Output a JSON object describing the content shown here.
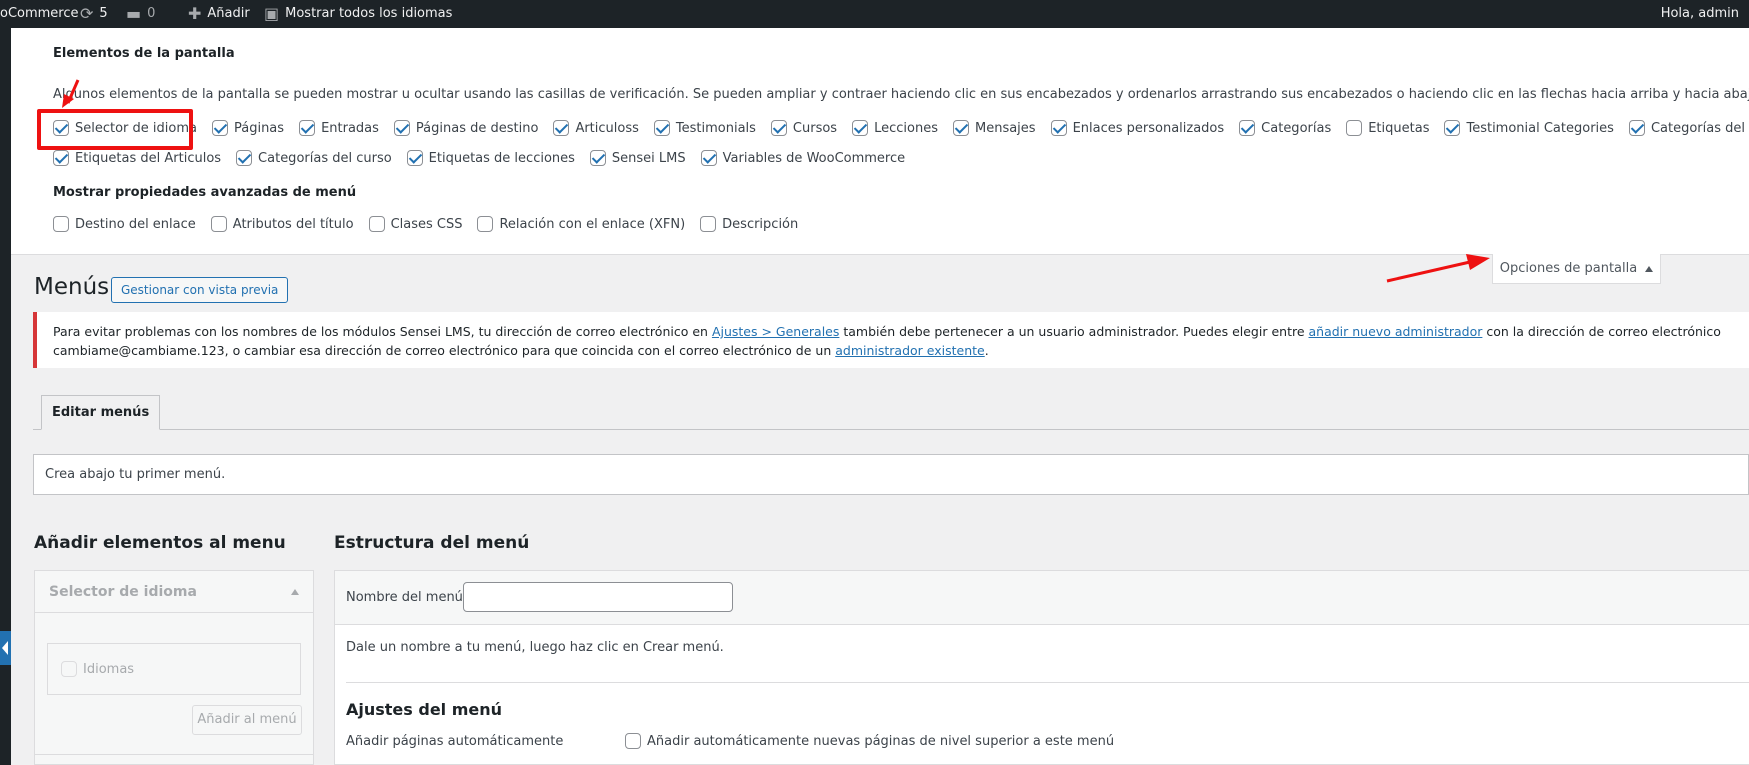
{
  "adminbar": {
    "site": "oCommerce",
    "updates_count": "5",
    "comments_count": "0",
    "add_new": "Añadir",
    "show_languages": "Mostrar todos los idiomas",
    "greeting": "Hola, admin"
  },
  "screen_options": {
    "heading": "Elementos de la pantalla",
    "description": "Algunos elementos de la pantalla se pueden mostrar u ocultar usando las casillas de verificación. Se pueden ampliar y contraer haciendo clic en sus encabezados y ordenarlos arrastrando sus encabezados o haciendo clic en las flechas hacia arriba y hacia abajo.",
    "row1": [
      {
        "label": "Selector de idioma",
        "checked": true
      },
      {
        "label": "Páginas",
        "checked": true
      },
      {
        "label": "Entradas",
        "checked": true
      },
      {
        "label": "Páginas de destino",
        "checked": true
      },
      {
        "label": "Articuloss",
        "checked": true
      },
      {
        "label": "Testimonials",
        "checked": true
      },
      {
        "label": "Cursos",
        "checked": true
      },
      {
        "label": "Lecciones",
        "checked": true
      },
      {
        "label": "Mensajes",
        "checked": true
      },
      {
        "label": "Enlaces personalizados",
        "checked": true
      },
      {
        "label": "Categorías",
        "checked": true
      },
      {
        "label": "Etiquetas",
        "checked": false
      },
      {
        "label": "Testimonial Categories",
        "checked": true
      },
      {
        "label": "Categorías del Articulos",
        "checked": true
      }
    ],
    "row2": [
      {
        "label": "Etiquetas del Articulos",
        "checked": true
      },
      {
        "label": "Categorías del curso",
        "checked": true
      },
      {
        "label": "Etiquetas de lecciones",
        "checked": true
      },
      {
        "label": "Sensei LMS",
        "checked": true
      },
      {
        "label": "Variables de WooCommerce",
        "checked": true
      }
    ],
    "advanced_heading": "Mostrar propiedades avanzadas de menú",
    "advanced": [
      {
        "label": "Destino del enlace",
        "checked": false
      },
      {
        "label": "Atributos del título",
        "checked": false
      },
      {
        "label": "Clases CSS",
        "checked": false
      },
      {
        "label": "Relación con el enlace (XFN)",
        "checked": false
      },
      {
        "label": "Descripción",
        "checked": false
      }
    ],
    "toggle_label": "Opciones de pantalla"
  },
  "page": {
    "title": "Menús",
    "manage_preview": "Gestionar con vista previa"
  },
  "notice": {
    "part1": "Para evitar problemas con los nombres de los módulos Sensei LMS, tu dirección de correo electrónico en ",
    "link1": "Ajustes > Generales",
    "part2": " también debe pertenecer a un usuario administrador. Puedes elegir entre ",
    "link2": "añadir nuevo administrador",
    "part3": " con la dirección de correo electrónico",
    "part4": "cambiame@cambiame.123, o cambiar esa dirección de correo electrónico para que coincida con el correo electrónico de un ",
    "link3": "administrador existente",
    "part5": "."
  },
  "tabs": {
    "edit_menus": "Editar menús"
  },
  "first_menu_hint": "Crea abajo tu primer menú.",
  "left_column": {
    "title": "Añadir elementos al menu",
    "panel_title": "Selector de idioma",
    "item_label": "Idiomas",
    "add_button": "Añadir al menú"
  },
  "right_column": {
    "title": "Estructura del menú",
    "menu_name_label": "Nombre del menú",
    "menu_name_value": "",
    "hint": "Dale un nombre a tu menú, luego haz clic en Crear menú.",
    "settings_title": "Ajustes del menú",
    "auto_add_label": "Añadir páginas automáticamente",
    "auto_add_checkbox": "Añadir automáticamente nuevas páginas de nivel superior a este menú"
  },
  "colors": {
    "admin_bar": "#1d2327",
    "accent_blue": "#2271b1",
    "notice_red": "#d63638",
    "annotation_red": "#ee1111"
  }
}
